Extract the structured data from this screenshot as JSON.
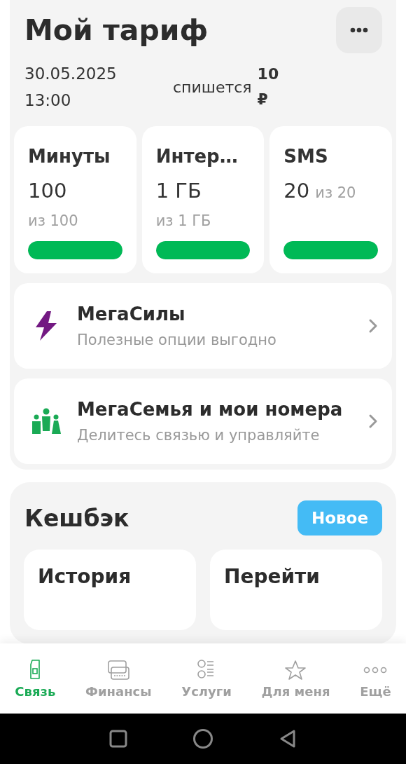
{
  "header": {
    "title": "Мой тариф",
    "date": "30.05.2025",
    "time": "13:00",
    "charge_label": "спишется",
    "charge_amount": "10",
    "charge_currency": "₽"
  },
  "counters": [
    {
      "title": "Минуты",
      "value": "100",
      "total": "из 100",
      "level": 1
    },
    {
      "title": "Интер…",
      "value": "1 ГБ",
      "total": "из 1 ГБ",
      "level": 1
    },
    {
      "title": "SMS",
      "value": "20",
      "total": "из 20",
      "level": 1
    }
  ],
  "links": [
    {
      "kind": "bolt",
      "title": "МегаСилы",
      "subtitle": "Полезные опции выгодно"
    },
    {
      "kind": "family",
      "title": "МегаСемья и мои номера",
      "subtitle": "Делитесь связью и управляйте"
    }
  ],
  "cashback": {
    "title": "Кешбэк",
    "badge": "Новое",
    "cards": [
      "История",
      "Перейти"
    ]
  },
  "bottom_nav": [
    {
      "kind": "sim",
      "label": "Связь",
      "selected": true
    },
    {
      "kind": "cards",
      "label": "Финансы",
      "selected": false
    },
    {
      "kind": "list",
      "label": "Услуги",
      "selected": false
    },
    {
      "kind": "star",
      "label": "Для меня",
      "selected": false
    },
    {
      "kind": "more",
      "label": "Ещё",
      "selected": false
    }
  ]
}
